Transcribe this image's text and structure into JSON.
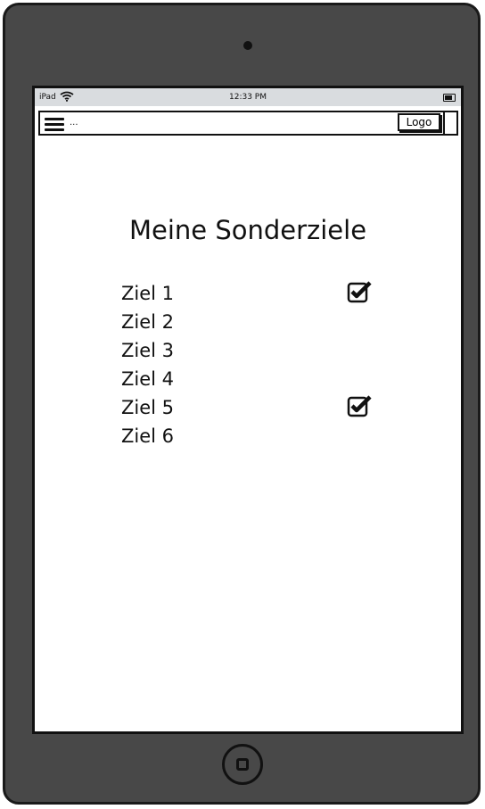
{
  "status_bar": {
    "carrier": "iPad",
    "time": "12:33 PM"
  },
  "navbar": {
    "text": "...",
    "logo_label": "Logo"
  },
  "page_title": "Meine Sonderziele",
  "items": [
    {
      "label": "Ziel 1",
      "checked": true
    },
    {
      "label": "Ziel 2",
      "checked": false
    },
    {
      "label": "Ziel 3",
      "checked": false
    },
    {
      "label": "Ziel 4",
      "checked": false
    },
    {
      "label": "Ziel 5",
      "checked": true
    },
    {
      "label": "Ziel 6",
      "checked": false
    }
  ],
  "icons": [
    "wifi-icon",
    "battery-icon",
    "menu-icon",
    "checkbox-checked-icon",
    "home-button-icon"
  ]
}
